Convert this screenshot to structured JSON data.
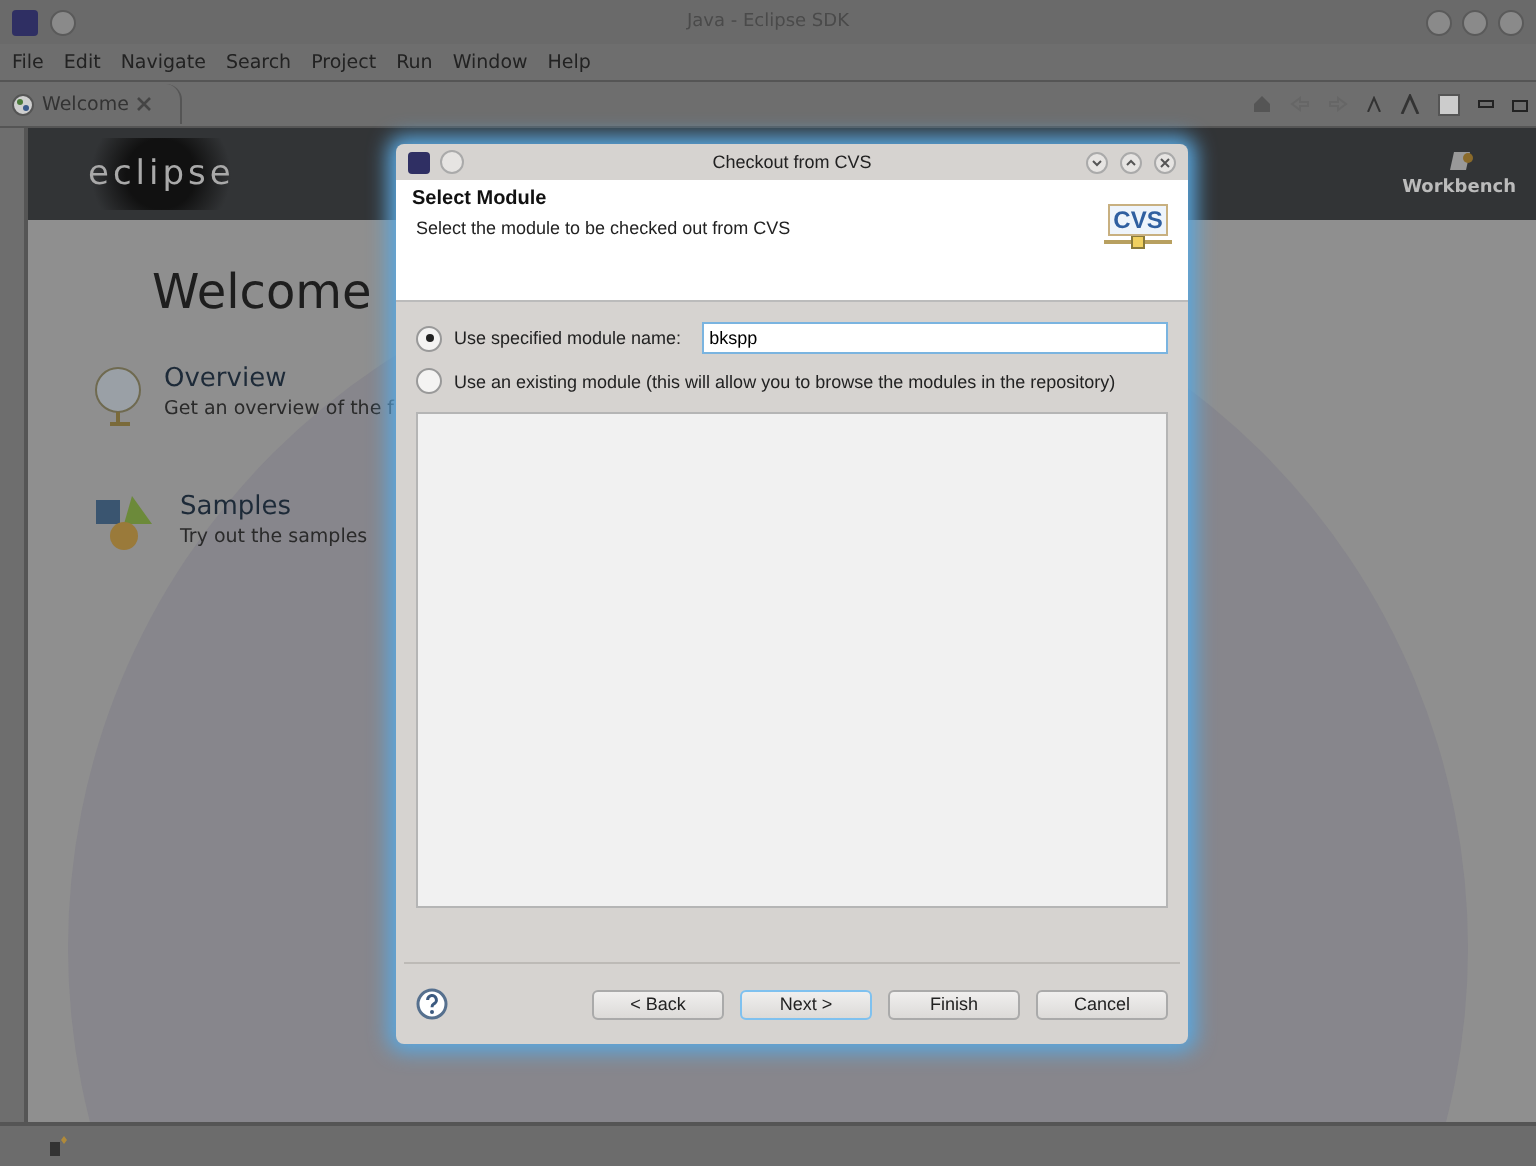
{
  "window": {
    "title": "Java - Eclipse SDK"
  },
  "menu": [
    "File",
    "Edit",
    "Navigate",
    "Search",
    "Project",
    "Run",
    "Window",
    "Help"
  ],
  "editor_tab": {
    "label": "Welcome"
  },
  "welcome": {
    "logo": "eclipse",
    "workbench": "Workbench",
    "heading": "Welcome",
    "items": [
      {
        "kind": "globe",
        "title": "Overview",
        "description": "Get an overview of the f"
      },
      {
        "kind": "shapes",
        "title": "Samples",
        "description": "Try out the samples"
      }
    ]
  },
  "dialog": {
    "title": "Checkout from CVS",
    "header_title": "Select Module",
    "header_description": "Select the module to be checked out from CVS",
    "logo": "CVS",
    "options": [
      {
        "kind": "field",
        "label": "Use specified module name:",
        "selected": true,
        "value": "bkspp"
      },
      {
        "kind": "plain",
        "label": "Use an existing module (this will allow you to browse the modules in the repository)",
        "selected": false
      }
    ],
    "buttons": [
      {
        "label": "< Back",
        "focused": false,
        "disabled": false
      },
      {
        "label": "Next >",
        "focused": true,
        "disabled": false
      },
      {
        "label": "Finish",
        "focused": false,
        "disabled": false
      },
      {
        "label": "Cancel",
        "focused": false,
        "disabled": false
      }
    ]
  }
}
